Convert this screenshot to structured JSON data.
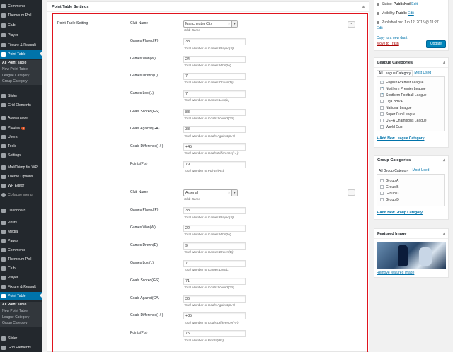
{
  "sidebar": {
    "top_items": [
      {
        "label": "Comments",
        "active": false
      },
      {
        "label": "Themeum Poll",
        "active": false
      },
      {
        "label": "Club",
        "active": false
      },
      {
        "label": "Player",
        "active": false
      },
      {
        "label": "Fixture & Reasult",
        "active": false
      },
      {
        "label": "Point Table",
        "active": true
      }
    ],
    "submenu": [
      "All Point Table",
      "New Point Table",
      "League Category",
      "Group Category"
    ],
    "mid_items": [
      {
        "label": "Slider"
      },
      {
        "label": "Grid Elements"
      },
      {
        "label": "Appearance"
      },
      {
        "label": "Plugins",
        "badge": "8"
      },
      {
        "label": "Users"
      },
      {
        "label": "Tools"
      },
      {
        "label": "Settings"
      },
      {
        "label": "MailChimp for WP"
      },
      {
        "label": "Theme Options"
      },
      {
        "label": "WP Editor"
      },
      {
        "label": "Collapse menu"
      }
    ],
    "bottom_items": [
      {
        "label": "Dashboard"
      },
      {
        "label": "Posts"
      },
      {
        "label": "Media"
      },
      {
        "label": "Pages"
      },
      {
        "label": "Comments"
      },
      {
        "label": "Themeum Poll"
      },
      {
        "label": "Club"
      },
      {
        "label": "Player"
      },
      {
        "label": "Fixture & Reasult"
      },
      {
        "label": "Point Table",
        "active": true
      }
    ],
    "submenu2": [
      "All Point Table",
      "New Point Table",
      "League Category",
      "Group Category"
    ],
    "tail_items": [
      {
        "label": "Slider"
      },
      {
        "label": "Grid Elements"
      }
    ]
  },
  "main": {
    "box_title": "Point Table Settings",
    "section_label": "Point Table Setting",
    "entries": [
      {
        "club_label": "Club Name",
        "club_value": "Manchester City",
        "club_desc": "Club Name",
        "fields": [
          {
            "label": "Games Played(P)",
            "value": "38",
            "desc": "Total Number of Games Played(P)"
          },
          {
            "label": "Games Won(W)",
            "value": "24",
            "desc": "Total Number of Games Won(W)"
          },
          {
            "label": "Games Drawn(D)",
            "value": "7",
            "desc": "Total Number of Games Drawn(D)"
          },
          {
            "label": "Games Lost(L)",
            "value": "7",
            "desc": "Total Number of Games Lost(L)"
          },
          {
            "label": "Goals Scored(GS)",
            "value": "83",
            "desc": "Total Number of Goals Scored(GS)"
          },
          {
            "label": "Goals Against(GA)",
            "value": "38",
            "desc": "Total Number of Goals Against(GA)"
          },
          {
            "label": "Goals Difference(+/-)",
            "value": "+45",
            "desc": "Total Number of Goals Difference(+/-)"
          },
          {
            "label": "Points(Pts)",
            "value": "79",
            "desc": "Total Number of Points(Pts)"
          }
        ]
      },
      {
        "club_label": "Club Name",
        "club_value": "Arsenal",
        "club_desc": "Club Name",
        "fields": [
          {
            "label": "Games Played(P)",
            "value": "38",
            "desc": "Total Number of Games Played(P)"
          },
          {
            "label": "Games Won(W)",
            "value": "22",
            "desc": "Total Number of Games Won(W)"
          },
          {
            "label": "Games Drawn(D)",
            "value": "9",
            "desc": "Total Number of Games Drawn(D)"
          },
          {
            "label": "Games Lost(L)",
            "value": "7",
            "desc": "Total Number of Games Lost(L)"
          },
          {
            "label": "Goals Scored(GS)",
            "value": "71",
            "desc": "Total Number of Goals Scored(GS)"
          },
          {
            "label": "Goals Against(GA)",
            "value": "36",
            "desc": "Total Number of Goals Against(GA)"
          },
          {
            "label": "Goals Difference(+/-)",
            "value": "+35",
            "desc": "Total Number of Goals Difference(+/-)"
          },
          {
            "label": "Points(Pts)",
            "value": "75",
            "desc": "Total Number of Points(Pts)"
          }
        ]
      }
    ],
    "remove_label": "-"
  },
  "publish": {
    "status_label": "Status:",
    "status_value": "Published",
    "status_edit": "Edit",
    "visibility_label": "Visibility:",
    "visibility_value": "Public",
    "visibility_edit": "Edit",
    "published_on": "Published on: Jun 12, 2015 @ 11:27",
    "published_edit": "Edit",
    "copy_link": "Copy to a new draft",
    "trash_link": "Move to Trash",
    "update_button": "Update"
  },
  "league_categories": {
    "title": "League Categories",
    "tab_all": "All League Category",
    "tab_used": "Most Used",
    "items": [
      {
        "label": "English Premier League",
        "checked": true
      },
      {
        "label": "Northern Premier League",
        "checked": true
      },
      {
        "label": "Southern Football League",
        "checked": true
      },
      {
        "label": "Liga BBVA",
        "checked": false
      },
      {
        "label": "National League",
        "checked": false
      },
      {
        "label": "Super Cup League",
        "checked": false
      },
      {
        "label": "UEFA Champions League",
        "checked": false
      },
      {
        "label": "World Cup",
        "checked": false
      }
    ],
    "add_new": "+ Add New League Category"
  },
  "group_categories": {
    "title": "Group Categories",
    "tab_all": "All Group Category",
    "tab_used": "Most Used",
    "items": [
      {
        "label": "Group A",
        "checked": false
      },
      {
        "label": "Group B",
        "checked": false
      },
      {
        "label": "Group C",
        "checked": false
      },
      {
        "label": "Group D",
        "checked": false
      }
    ],
    "add_new": "+ Add New Group Category"
  },
  "featured_image": {
    "title": "Featured Image",
    "remove_link": "Remove featured image"
  },
  "colors": {
    "sidebar_bg": "#23282d",
    "active_blue": "#0073aa",
    "highlight_red": "#e0141e"
  }
}
